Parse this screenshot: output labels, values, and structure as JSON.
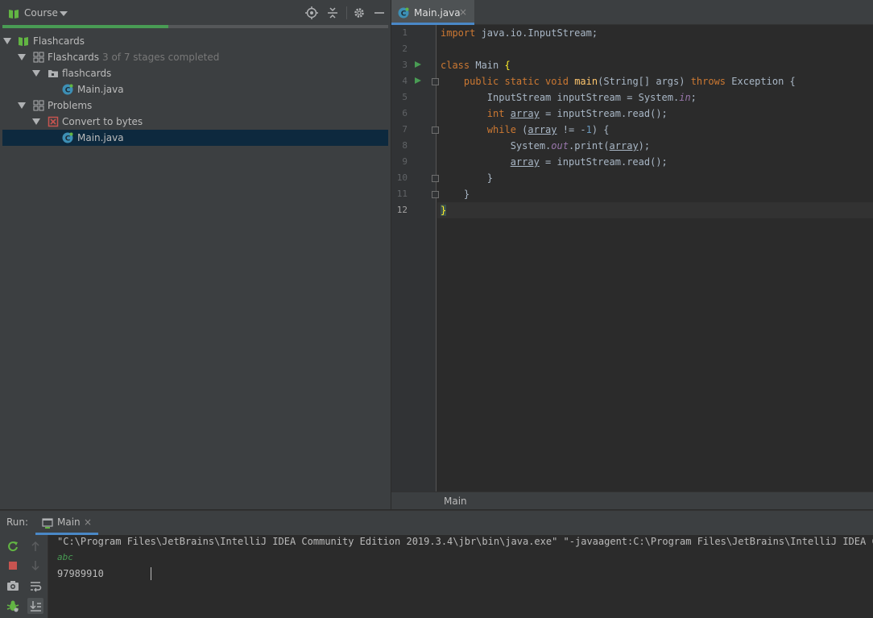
{
  "course_panel": {
    "title": "Course",
    "progress_fraction": 0.43,
    "tree": [
      {
        "label": "Flashcards",
        "sub": "",
        "depth": 0,
        "icon": "course-book-icon"
      },
      {
        "label": "Flashcards",
        "sub": "3 of 7 stages completed",
        "depth": 1,
        "icon": "lesson-grid-icon"
      },
      {
        "label": "flashcards",
        "sub": "",
        "depth": 2,
        "icon": "folder-icon"
      },
      {
        "label": "Main.java",
        "sub": "",
        "depth": 3,
        "icon": "java-class-icon"
      },
      {
        "label": "Problems",
        "sub": "",
        "depth": 1,
        "icon": "lesson-grid-icon"
      },
      {
        "label": "Convert to bytes",
        "sub": "",
        "depth": 2,
        "icon": "failed-task-icon"
      },
      {
        "label": "Main.java",
        "sub": "",
        "depth": 3,
        "icon": "java-class-icon"
      }
    ]
  },
  "editor": {
    "tab_label": "Main.java",
    "tab_close": "×",
    "breadcrumb": "Main",
    "line_numbers": [
      "1",
      "2",
      "3",
      "4",
      "5",
      "6",
      "7",
      "8",
      "9",
      "10",
      "11",
      "12"
    ]
  },
  "run_panel": {
    "label": "Run:",
    "tab_label": "Main",
    "tab_close": "×",
    "console": {
      "command": "\"C:\\Program Files\\JetBrains\\IntelliJ IDEA Community Edition 2019.3.4\\jbr\\bin\\java.exe\" \"-javaagent:C:\\Program Files\\JetBrains\\IntelliJ IDEA Commu",
      "input": "abc",
      "output": "97989910"
    }
  },
  "colors": {
    "accent": "#4a88c7",
    "progress": "#499c54",
    "selection": "#0d293e"
  }
}
